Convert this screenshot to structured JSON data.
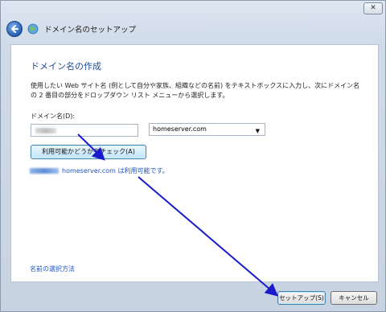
{
  "window": {
    "close_glyph": "✕",
    "title": "ドメイン名のセットアップ"
  },
  "icons": {
    "back": "back-arrow-icon",
    "globe": "globe-icon"
  },
  "main": {
    "heading": "ドメイン名の作成",
    "description": "使用したい Web サイト名 (例として自分や家族、組織などの名前) をテキストボックスに入力し、次にドメイン名の 2 番目の部分をドロップダウン リスト メニューから選択します。",
    "field_label": "ドメイン名(D):",
    "separator": ".",
    "domain_select": "homeserver.com",
    "check_button": "利用可能かどうかをチェック(A)",
    "availability_text": "homeserver.com は利用可能です。",
    "help_link": "名前の選択方法"
  },
  "footer": {
    "setup_button": "セットアップ(S)",
    "cancel_button": "キャンセル"
  },
  "colors": {
    "heading": "#1f4b99",
    "link": "#1f54c4",
    "annotation_arrow": "#1a1acc"
  }
}
